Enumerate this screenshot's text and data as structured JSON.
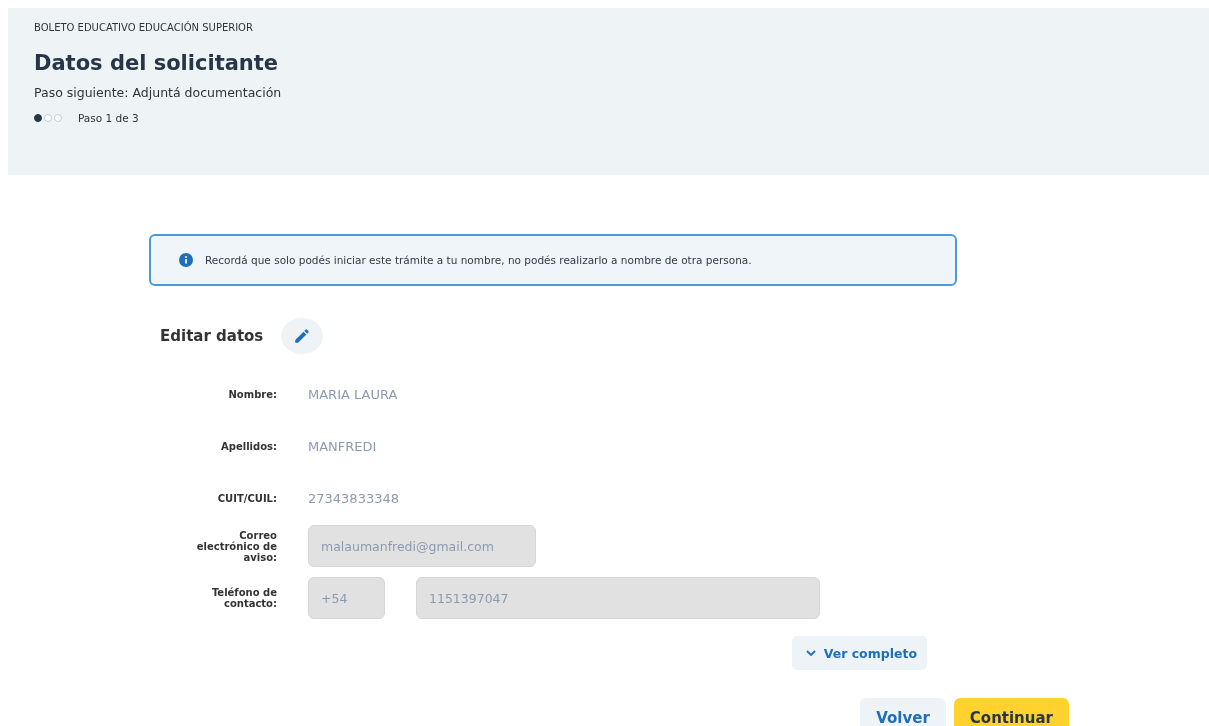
{
  "header": {
    "eyebrow": "BOLETO EDUCATIVO EDUCACIÓN SUPERIOR",
    "title": "Datos del solicitante",
    "next_step": "Paso siguiente: Adjuntá documentación",
    "steps": [
      {
        "done": true
      },
      {
        "done": false
      },
      {
        "done": false
      }
    ],
    "step_label": "Paso 1 de 3"
  },
  "alert": {
    "text": "Recordá que solo podés iniciar este trámite a tu nombre, no podés realizarlo a nombre de otra persona."
  },
  "section": {
    "title": "Editar datos"
  },
  "fields": [
    {
      "kind": "text",
      "label": "Nombre:",
      "value": "MARIA LAURA"
    },
    {
      "kind": "text",
      "label": "Apellidos:",
      "value": "MANFREDI"
    },
    {
      "kind": "text",
      "label": "CUIT/CUIL:",
      "value": "27343833348"
    },
    {
      "kind": "input",
      "label": "Correo electrónico de aviso:",
      "value": "malaumanfredi@gmail.com",
      "disabled": true
    },
    {
      "kind": "phone",
      "label": "Teléfono de contacto:",
      "prefix": "+54",
      "value": "1151397047",
      "disabled": true
    }
  ],
  "expand_button": "Ver completo",
  "buttons": [
    {
      "kind": "secondary",
      "label": "Volver"
    },
    {
      "kind": "primary",
      "label": "Continuar"
    }
  ]
}
